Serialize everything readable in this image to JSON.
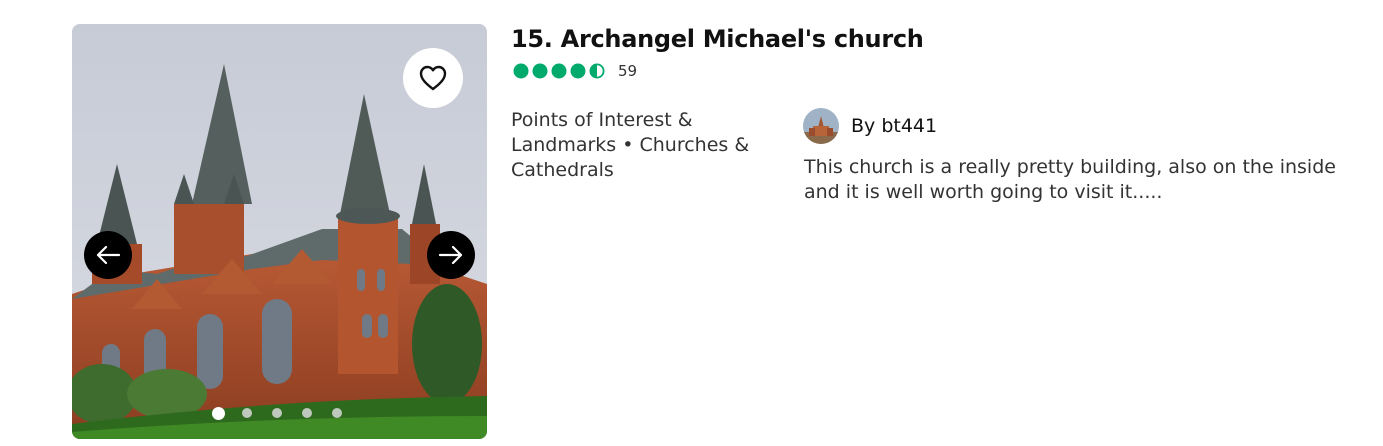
{
  "listing": {
    "title": "15. Archangel Michael's church",
    "rating_value": 4.5,
    "rating_max": 5,
    "review_count": "59",
    "category": "Points of Interest & Landmarks • Churches & Cathedrals",
    "colors": {
      "rating": "#00aa6c"
    }
  },
  "gallery": {
    "image": "church-photo",
    "dots": 5,
    "active_dot": 1,
    "icons": {
      "favorite": "heart-icon",
      "prev": "arrow-left-icon",
      "next": "arrow-right-icon"
    }
  },
  "review": {
    "author": "By bt441",
    "text": "This church is a really pretty building, also on the inside and it is well worth going to visit it....."
  }
}
